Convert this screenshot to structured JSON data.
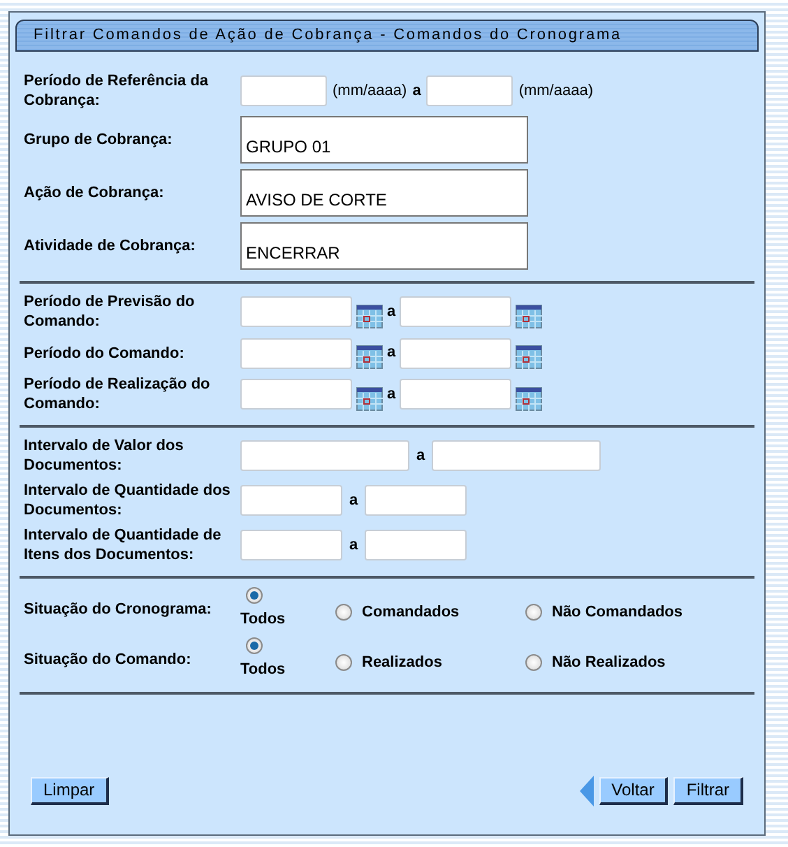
{
  "title": "Filtrar Comandos de Ação de Cobrança - Comandos do Cronograma",
  "sections": [
    {
      "rows": [
        {
          "kind": "month-range",
          "label": "Período de Referência da Cobrança:",
          "unit_from": "(mm/aaaa)",
          "separator": "a",
          "unit_to": "(mm/aaaa)"
        },
        {
          "kind": "listbox",
          "label": "Grupo de Cobrança:",
          "items": [
            "GRUPO 01"
          ]
        },
        {
          "kind": "listbox",
          "label": "Ação de Cobrança:",
          "items": [
            "AVISO DE CORTE"
          ]
        },
        {
          "kind": "listbox",
          "label": "Atividade de Cobrança:",
          "items": [
            "ENCERRAR"
          ]
        }
      ]
    },
    {
      "rows": [
        {
          "kind": "date-range",
          "label": "Período de Previsão do Comando:",
          "separator": "a"
        },
        {
          "kind": "date-range",
          "label": "Período do Comando:",
          "separator": "a"
        },
        {
          "kind": "date-range",
          "label": "Período de Realização do Comando:",
          "separator": "a"
        }
      ]
    },
    {
      "rows": [
        {
          "kind": "value-range",
          "label": "Intervalo de Valor dos Documentos:",
          "separator": "a"
        },
        {
          "kind": "count-range",
          "label": "Intervalo de Quantidade dos Documentos:",
          "separator": "a"
        },
        {
          "kind": "count-range",
          "label": "Intervalo de Quantidade de Itens dos Documentos:",
          "separator": "a"
        }
      ]
    },
    {
      "rows": [
        {
          "kind": "radio",
          "label": "Situação do Cronograma:",
          "options": [
            {
              "label": "Todos",
              "selected": true
            },
            {
              "label": "Comandados",
              "selected": false
            },
            {
              "label": "Não Comandados",
              "selected": false
            }
          ]
        },
        {
          "kind": "radio",
          "label": "Situação do Comando:",
          "options": [
            {
              "label": "Todos",
              "selected": true
            },
            {
              "label": "Realizados",
              "selected": false
            },
            {
              "label": "Não Realizados",
              "selected": false
            }
          ]
        }
      ]
    }
  ],
  "buttons": {
    "left": [
      "Limpar"
    ],
    "right": [
      "Voltar",
      "Filtrar"
    ]
  }
}
